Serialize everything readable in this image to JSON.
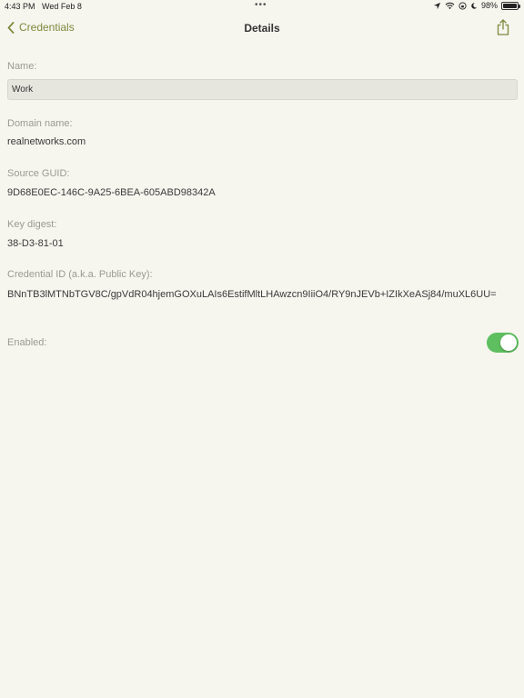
{
  "status_bar": {
    "time": "4:43 PM",
    "date": "Wed Feb 8",
    "dots": "•••",
    "battery": "98%",
    "battery_level": 0.98
  },
  "nav": {
    "back_label": "Credentials",
    "title": "Details"
  },
  "form": {
    "name_label": "Name:",
    "name_value": "Work",
    "domain_label": "Domain name:",
    "domain_value": "realnetworks.com",
    "guid_label": "Source GUID:",
    "guid_value": "9D68E0EC-146C-9A25-6BEA-605ABD98342A",
    "digest_label": "Key digest:",
    "digest_value": "38-D3-81-01",
    "credential_label": "Credential ID (a.k.a. Public Key):",
    "credential_value": "BNnTB3lMTNbTGV8C/gpVdR04hjemGOXuLAIs6EstifMltLHAwzcn9IiiO4/RY9nJEVb+IZIkXeASj84/muXL6UU=",
    "enabled_label": "Enabled:",
    "enabled": true
  },
  "colors": {
    "accent": "#7d8a3e",
    "toggle_on": "#5fbe60",
    "background": "#f6f5ee"
  }
}
